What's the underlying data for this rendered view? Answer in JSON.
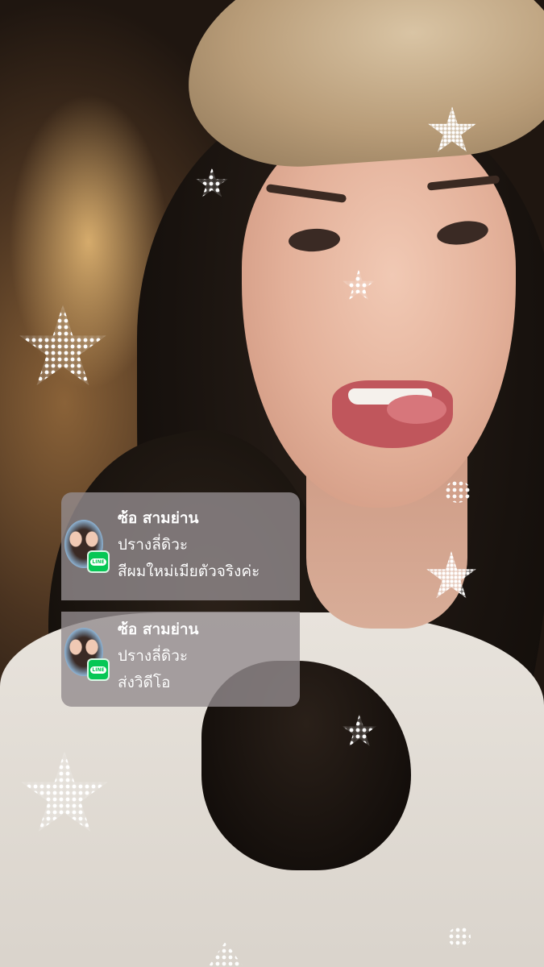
{
  "notifications": [
    {
      "app_icon": "line-app-icon",
      "app_badge_text": "LINE",
      "sender": "ซ้อ สามย่าน",
      "title": "ปรางลี่ดิวะ",
      "message": "สีผมใหม่เมียตัวจริงค่ะ"
    },
    {
      "app_icon": "line-app-icon",
      "app_badge_text": "LINE",
      "sender": "ซ้อ สามย่าน",
      "title": "ปรางลี่ดิวะ",
      "message": "ส่งวิดีโอ"
    }
  ],
  "colors": {
    "line_green": "#06C755",
    "notification_bg": "#948C8E",
    "sparkle": "#FFFFFF"
  },
  "background": {
    "type": "selfie-photo",
    "decorations": "white-dotted-sparkle-stars"
  }
}
